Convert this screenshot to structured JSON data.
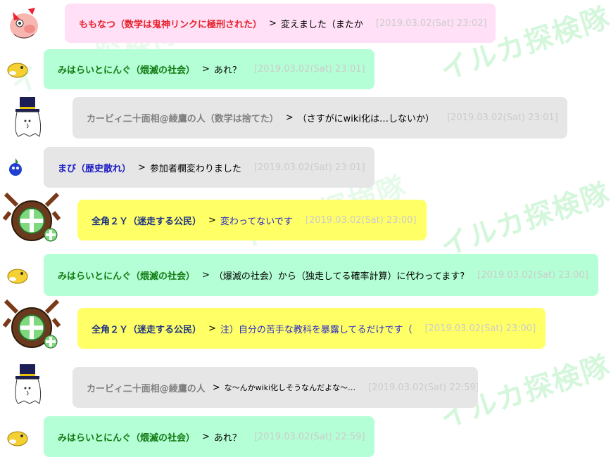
{
  "watermark": "イルカ探検隊",
  "colors": {
    "pink": "#ffe0f6",
    "mint": "#b4ffd5",
    "grey": "#e6e6e6",
    "yellow": "#ffff66",
    "name_red": "#e8202a",
    "name_green": "#137a13",
    "name_grey": "#808080",
    "name_blue": "#1c1cc4",
    "name_navy": "#1a2f80",
    "msg_blue": "#2a2ac8",
    "timestamp": "#cccccc"
  },
  "messages": [
    {
      "name": "ももなつ（数学は鬼神リンクに極刑された）",
      "arrow": ">",
      "text": "変えました（またか",
      "time": "[2019.03.02(Sat) 23:02]",
      "avatar": "pig-avatar-icon"
    },
    {
      "name": "みはらいとにんぐ（煨滅の社会）",
      "arrow": ">",
      "text": "あれ？",
      "time": "[2019.03.02(Sat) 23:01]",
      "avatar": "hamster-avatar-icon"
    },
    {
      "name": "カービィ二十面相@綾鷹の人（数学は捨てた）",
      "arrow": ">",
      "text": "（さすがにwiki化は…しないか）",
      "time": "[2019.03.02(Sat) 23:01]",
      "avatar": "tophat-ghost-avatar-icon"
    },
    {
      "name": "まび（歴史散れ）",
      "arrow": ">",
      "text": "参加者欄変わりました",
      "time": "[2019.03.02(Sat) 23:01]",
      "avatar": "blue-sprite-avatar-icon"
    },
    {
      "name": "全角２Ｙ（迷走する公民）",
      "arrow": ">",
      "text": "変わってないです",
      "time": "[2019.03.02(Sat) 23:00]",
      "avatar": "shield-monster-avatar-icon"
    },
    {
      "name": "みはらいとにんぐ（煨滅の社会）",
      "arrow": ">",
      "text": "（爆滅の社会）から（独走してる確率計算）に代わってます?",
      "time": "[2019.03.02(Sat) 23:00]",
      "avatar": "hamster-avatar-icon"
    },
    {
      "name": "全角２Ｙ（迷走する公民）",
      "arrow": ">",
      "text": "注）自分の苦手な教科を暴露してるだけです（",
      "time": "[2019.03.02(Sat) 23:00]",
      "avatar": "shield-monster-avatar-icon"
    },
    {
      "name": "カービィ二十面相@綾鷹の人",
      "arrow": ">",
      "text": "な〜んかwiki化しそうなんだよな〜…",
      "time": "[2019.03.02(Sat) 22:59]",
      "avatar": "tophat-ghost-avatar-icon"
    },
    {
      "name": "みはらいとにんぐ（煨滅の社会）",
      "arrow": ">",
      "text": "あれ？",
      "time": "[2019.03.02(Sat) 22:59]",
      "avatar": "hamster-avatar-icon"
    }
  ]
}
